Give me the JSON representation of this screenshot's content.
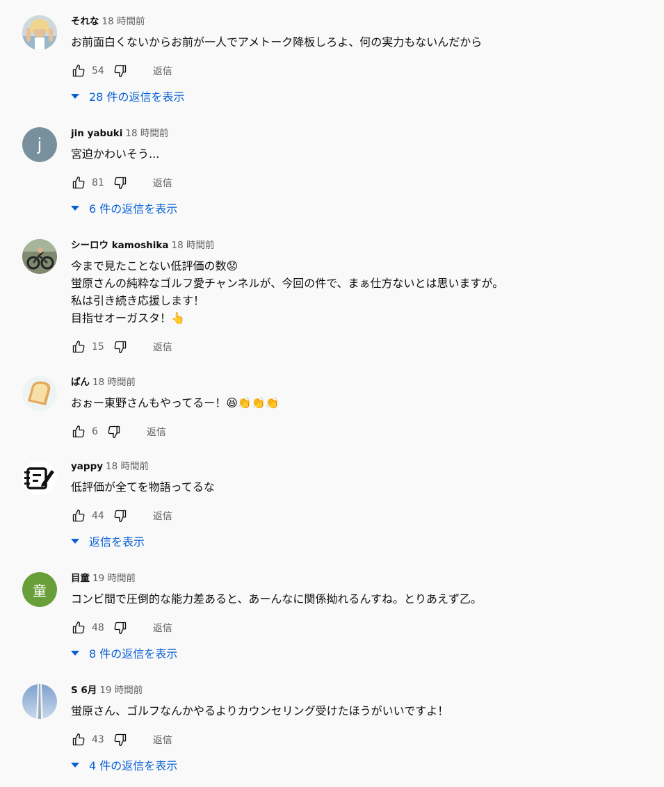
{
  "comments": [
    {
      "author": "それな",
      "time": "18 時間前",
      "lines": [
        "お前面白くないからお前が一人でアメトーク降板しろよ、何の実力もないんだから"
      ],
      "likes": "54",
      "reply_label": "返信",
      "replies_label": "28 件の返信を表示",
      "avatar": {
        "type": "photo",
        "color": "#d9b38c"
      }
    },
    {
      "author": "jin yabuki",
      "time": "18 時間前",
      "lines": [
        "宮迫かわいそう..."
      ],
      "likes": "81",
      "reply_label": "返信",
      "replies_label": "6 件の返信を表示",
      "avatar": {
        "type": "letter",
        "letter": "j",
        "color": "#78909c"
      }
    },
    {
      "author": "シーロウ kamoshika",
      "time": "18 時間前",
      "lines": [
        "今まで見たことない低評価の数😟",
        "蛍原さんの純粋なゴルフ愛チャンネルが、今回の件で、まぁ仕方ないとは思いますが。",
        "私は引き続き応援します！",
        "目指せオーガスタ！👆"
      ],
      "likes": "15",
      "reply_label": "返信",
      "replies_label": "",
      "avatar": {
        "type": "photo",
        "color": "#6d7356"
      }
    },
    {
      "author": "ぱん",
      "time": "18 時間前",
      "lines": [
        "おぉー東野さんもやってるー！😆👏👏👏"
      ],
      "likes": "6",
      "reply_label": "返信",
      "replies_label": "",
      "avatar": {
        "type": "bread",
        "color": "#e9b96e"
      }
    },
    {
      "author": "yappy",
      "time": "18 時間前",
      "lines": [
        "低評価が全てを物語ってるな"
      ],
      "likes": "44",
      "reply_label": "返信",
      "replies_label": "返信を表示",
      "avatar": {
        "type": "note",
        "color": "#111111"
      }
    },
    {
      "author": "目童",
      "time": "19 時間前",
      "lines": [
        "コンビ間で圧倒的な能力差あると、あーんなに関係拗れるんすね。とりあえず乙。"
      ],
      "likes": "48",
      "reply_label": "返信",
      "replies_label": "8 件の返信を表示",
      "avatar": {
        "type": "letter",
        "letter": "童",
        "color": "#689f38"
      }
    },
    {
      "author": "S 6月",
      "time": "19 時間前",
      "lines": [
        "蛍原さん、ゴルフなんかやるよりカウンセリング受けたほうがいいですよ！"
      ],
      "likes": "43",
      "reply_label": "返信",
      "replies_label": "4 件の返信を表示",
      "avatar": {
        "type": "photo",
        "color": "#8ea7c9"
      }
    }
  ],
  "icons": {
    "like": "thumb-up-icon",
    "dislike": "thumb-down-icon",
    "expand": "expand-triangle-icon"
  }
}
